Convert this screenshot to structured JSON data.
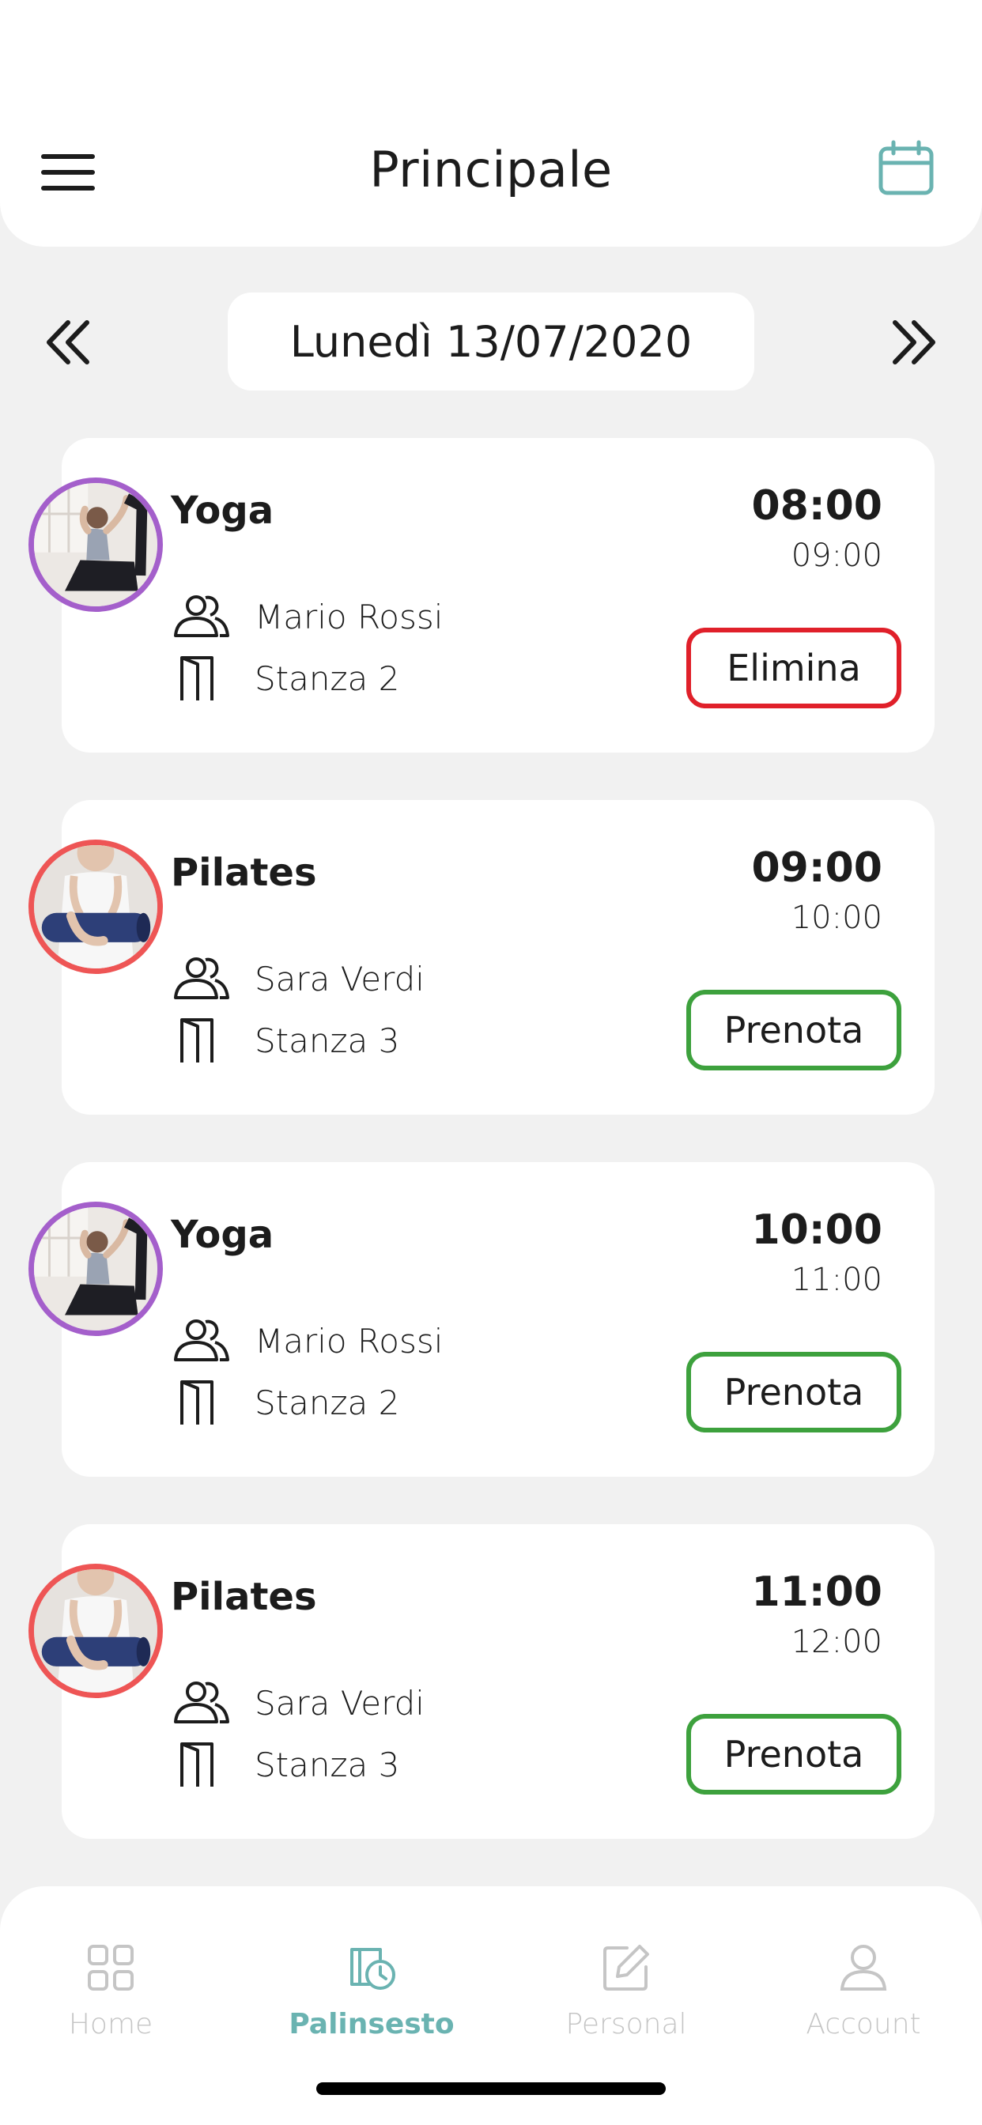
{
  "header": {
    "title": "Principale"
  },
  "date_nav": {
    "date_label": "Lunedì 13/07/2020"
  },
  "classes": [
    {
      "title": "Yoga",
      "start": "08:00",
      "end": "09:00",
      "trainer": "Mario Rossi",
      "room": "Stanza 2",
      "action": "Elimina"
    },
    {
      "title": "Pilates",
      "start": "09:00",
      "end": "10:00",
      "trainer": "Sara Verdi",
      "room": "Stanza 3",
      "action": "Prenota"
    },
    {
      "title": "Yoga",
      "start": "10:00",
      "end": "11:00",
      "trainer": "Mario Rossi",
      "room": "Stanza 2",
      "action": "Prenota"
    },
    {
      "title": "Pilates",
      "start": "11:00",
      "end": "12:00",
      "trainer": "Sara Verdi",
      "room": "Stanza 3",
      "action": "Prenota"
    }
  ],
  "bottom_nav": {
    "items": [
      {
        "label": "Home",
        "icon": "grid-icon"
      },
      {
        "label": "Palinsesto",
        "icon": "schedule-icon"
      },
      {
        "label": "Personal",
        "icon": "edit-icon"
      },
      {
        "label": "Account",
        "icon": "user-icon"
      }
    ],
    "active": "Palinsesto"
  },
  "colors": {
    "accent": "#6ab3b1",
    "book_border": "#3da13d",
    "delete_border": "#e0202a",
    "yoga_ring": "#a45fcb",
    "pilates_ring": "#ee5555"
  }
}
